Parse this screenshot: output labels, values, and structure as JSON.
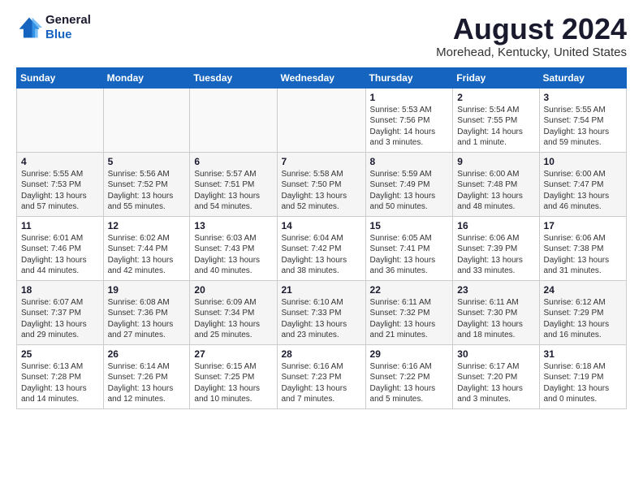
{
  "header": {
    "logo_line1": "General",
    "logo_line2": "Blue",
    "main_title": "August 2024",
    "sub_title": "Morehead, Kentucky, United States"
  },
  "days_of_week": [
    "Sunday",
    "Monday",
    "Tuesday",
    "Wednesday",
    "Thursday",
    "Friday",
    "Saturday"
  ],
  "weeks": [
    {
      "row_class": "row-odd",
      "days": [
        {
          "num": "",
          "info": "",
          "empty": true
        },
        {
          "num": "",
          "info": "",
          "empty": true
        },
        {
          "num": "",
          "info": "",
          "empty": true
        },
        {
          "num": "",
          "info": "",
          "empty": true
        },
        {
          "num": "1",
          "info": "Sunrise: 5:53 AM\nSunset: 7:56 PM\nDaylight: 14 hours\nand 3 minutes.",
          "empty": false
        },
        {
          "num": "2",
          "info": "Sunrise: 5:54 AM\nSunset: 7:55 PM\nDaylight: 14 hours\nand 1 minute.",
          "empty": false
        },
        {
          "num": "3",
          "info": "Sunrise: 5:55 AM\nSunset: 7:54 PM\nDaylight: 13 hours\nand 59 minutes.",
          "empty": false
        }
      ]
    },
    {
      "row_class": "row-even",
      "days": [
        {
          "num": "4",
          "info": "Sunrise: 5:55 AM\nSunset: 7:53 PM\nDaylight: 13 hours\nand 57 minutes.",
          "empty": false
        },
        {
          "num": "5",
          "info": "Sunrise: 5:56 AM\nSunset: 7:52 PM\nDaylight: 13 hours\nand 55 minutes.",
          "empty": false
        },
        {
          "num": "6",
          "info": "Sunrise: 5:57 AM\nSunset: 7:51 PM\nDaylight: 13 hours\nand 54 minutes.",
          "empty": false
        },
        {
          "num": "7",
          "info": "Sunrise: 5:58 AM\nSunset: 7:50 PM\nDaylight: 13 hours\nand 52 minutes.",
          "empty": false
        },
        {
          "num": "8",
          "info": "Sunrise: 5:59 AM\nSunset: 7:49 PM\nDaylight: 13 hours\nand 50 minutes.",
          "empty": false
        },
        {
          "num": "9",
          "info": "Sunrise: 6:00 AM\nSunset: 7:48 PM\nDaylight: 13 hours\nand 48 minutes.",
          "empty": false
        },
        {
          "num": "10",
          "info": "Sunrise: 6:00 AM\nSunset: 7:47 PM\nDaylight: 13 hours\nand 46 minutes.",
          "empty": false
        }
      ]
    },
    {
      "row_class": "row-odd",
      "days": [
        {
          "num": "11",
          "info": "Sunrise: 6:01 AM\nSunset: 7:46 PM\nDaylight: 13 hours\nand 44 minutes.",
          "empty": false
        },
        {
          "num": "12",
          "info": "Sunrise: 6:02 AM\nSunset: 7:44 PM\nDaylight: 13 hours\nand 42 minutes.",
          "empty": false
        },
        {
          "num": "13",
          "info": "Sunrise: 6:03 AM\nSunset: 7:43 PM\nDaylight: 13 hours\nand 40 minutes.",
          "empty": false
        },
        {
          "num": "14",
          "info": "Sunrise: 6:04 AM\nSunset: 7:42 PM\nDaylight: 13 hours\nand 38 minutes.",
          "empty": false
        },
        {
          "num": "15",
          "info": "Sunrise: 6:05 AM\nSunset: 7:41 PM\nDaylight: 13 hours\nand 36 minutes.",
          "empty": false
        },
        {
          "num": "16",
          "info": "Sunrise: 6:06 AM\nSunset: 7:39 PM\nDaylight: 13 hours\nand 33 minutes.",
          "empty": false
        },
        {
          "num": "17",
          "info": "Sunrise: 6:06 AM\nSunset: 7:38 PM\nDaylight: 13 hours\nand 31 minutes.",
          "empty": false
        }
      ]
    },
    {
      "row_class": "row-even",
      "days": [
        {
          "num": "18",
          "info": "Sunrise: 6:07 AM\nSunset: 7:37 PM\nDaylight: 13 hours\nand 29 minutes.",
          "empty": false
        },
        {
          "num": "19",
          "info": "Sunrise: 6:08 AM\nSunset: 7:36 PM\nDaylight: 13 hours\nand 27 minutes.",
          "empty": false
        },
        {
          "num": "20",
          "info": "Sunrise: 6:09 AM\nSunset: 7:34 PM\nDaylight: 13 hours\nand 25 minutes.",
          "empty": false
        },
        {
          "num": "21",
          "info": "Sunrise: 6:10 AM\nSunset: 7:33 PM\nDaylight: 13 hours\nand 23 minutes.",
          "empty": false
        },
        {
          "num": "22",
          "info": "Sunrise: 6:11 AM\nSunset: 7:32 PM\nDaylight: 13 hours\nand 21 minutes.",
          "empty": false
        },
        {
          "num": "23",
          "info": "Sunrise: 6:11 AM\nSunset: 7:30 PM\nDaylight: 13 hours\nand 18 minutes.",
          "empty": false
        },
        {
          "num": "24",
          "info": "Sunrise: 6:12 AM\nSunset: 7:29 PM\nDaylight: 13 hours\nand 16 minutes.",
          "empty": false
        }
      ]
    },
    {
      "row_class": "row-odd",
      "days": [
        {
          "num": "25",
          "info": "Sunrise: 6:13 AM\nSunset: 7:28 PM\nDaylight: 13 hours\nand 14 minutes.",
          "empty": false
        },
        {
          "num": "26",
          "info": "Sunrise: 6:14 AM\nSunset: 7:26 PM\nDaylight: 13 hours\nand 12 minutes.",
          "empty": false
        },
        {
          "num": "27",
          "info": "Sunrise: 6:15 AM\nSunset: 7:25 PM\nDaylight: 13 hours\nand 10 minutes.",
          "empty": false
        },
        {
          "num": "28",
          "info": "Sunrise: 6:16 AM\nSunset: 7:23 PM\nDaylight: 13 hours\nand 7 minutes.",
          "empty": false
        },
        {
          "num": "29",
          "info": "Sunrise: 6:16 AM\nSunset: 7:22 PM\nDaylight: 13 hours\nand 5 minutes.",
          "empty": false
        },
        {
          "num": "30",
          "info": "Sunrise: 6:17 AM\nSunset: 7:20 PM\nDaylight: 13 hours\nand 3 minutes.",
          "empty": false
        },
        {
          "num": "31",
          "info": "Sunrise: 6:18 AM\nSunset: 7:19 PM\nDaylight: 13 hours\nand 0 minutes.",
          "empty": false
        }
      ]
    }
  ]
}
